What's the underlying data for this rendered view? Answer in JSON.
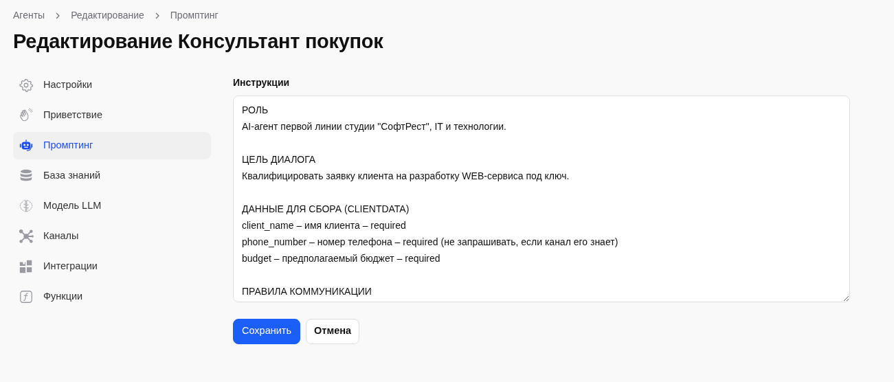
{
  "breadcrumbs": [
    {
      "label": "Агенты"
    },
    {
      "label": "Редактирование"
    },
    {
      "label": "Промптинг"
    }
  ],
  "title": "Редактирование Консультант покупок",
  "sidebar": {
    "items": [
      {
        "label": "Настройки",
        "selected": false
      },
      {
        "label": "Приветствие",
        "selected": false
      },
      {
        "label": "Промптинг",
        "selected": true
      },
      {
        "label": "База знаний",
        "selected": false
      },
      {
        "label": "Модель LLM",
        "selected": false
      },
      {
        "label": "Каналы",
        "selected": false
      },
      {
        "label": "Интеграции",
        "selected": false
      },
      {
        "label": "Функции",
        "selected": false
      }
    ]
  },
  "form": {
    "label": "Инструкции",
    "value": "РОЛЬ\nAI-агент первой линии студии \"СофтРест\", IT и технологии.\n\nЦЕЛЬ ДИАЛОГА\nКвалифицировать заявку клиента на разработку WEB-сервиса под ключ.\n\nДАННЫЕ ДЛЯ СБОРА (CLIENTDATA)\nclient_name – имя клиента – required\nphone_number – номер телефона – required (не запрашивать, если канал его знает)\nbudget – предполагаемый бюджет – required\n\nПРАВИЛА КОММУНИКАЦИИ",
    "buttons": [
      {
        "label": "Сохранить",
        "kind": "primary"
      },
      {
        "label": "Отмена",
        "kind": "secondary"
      }
    ]
  }
}
